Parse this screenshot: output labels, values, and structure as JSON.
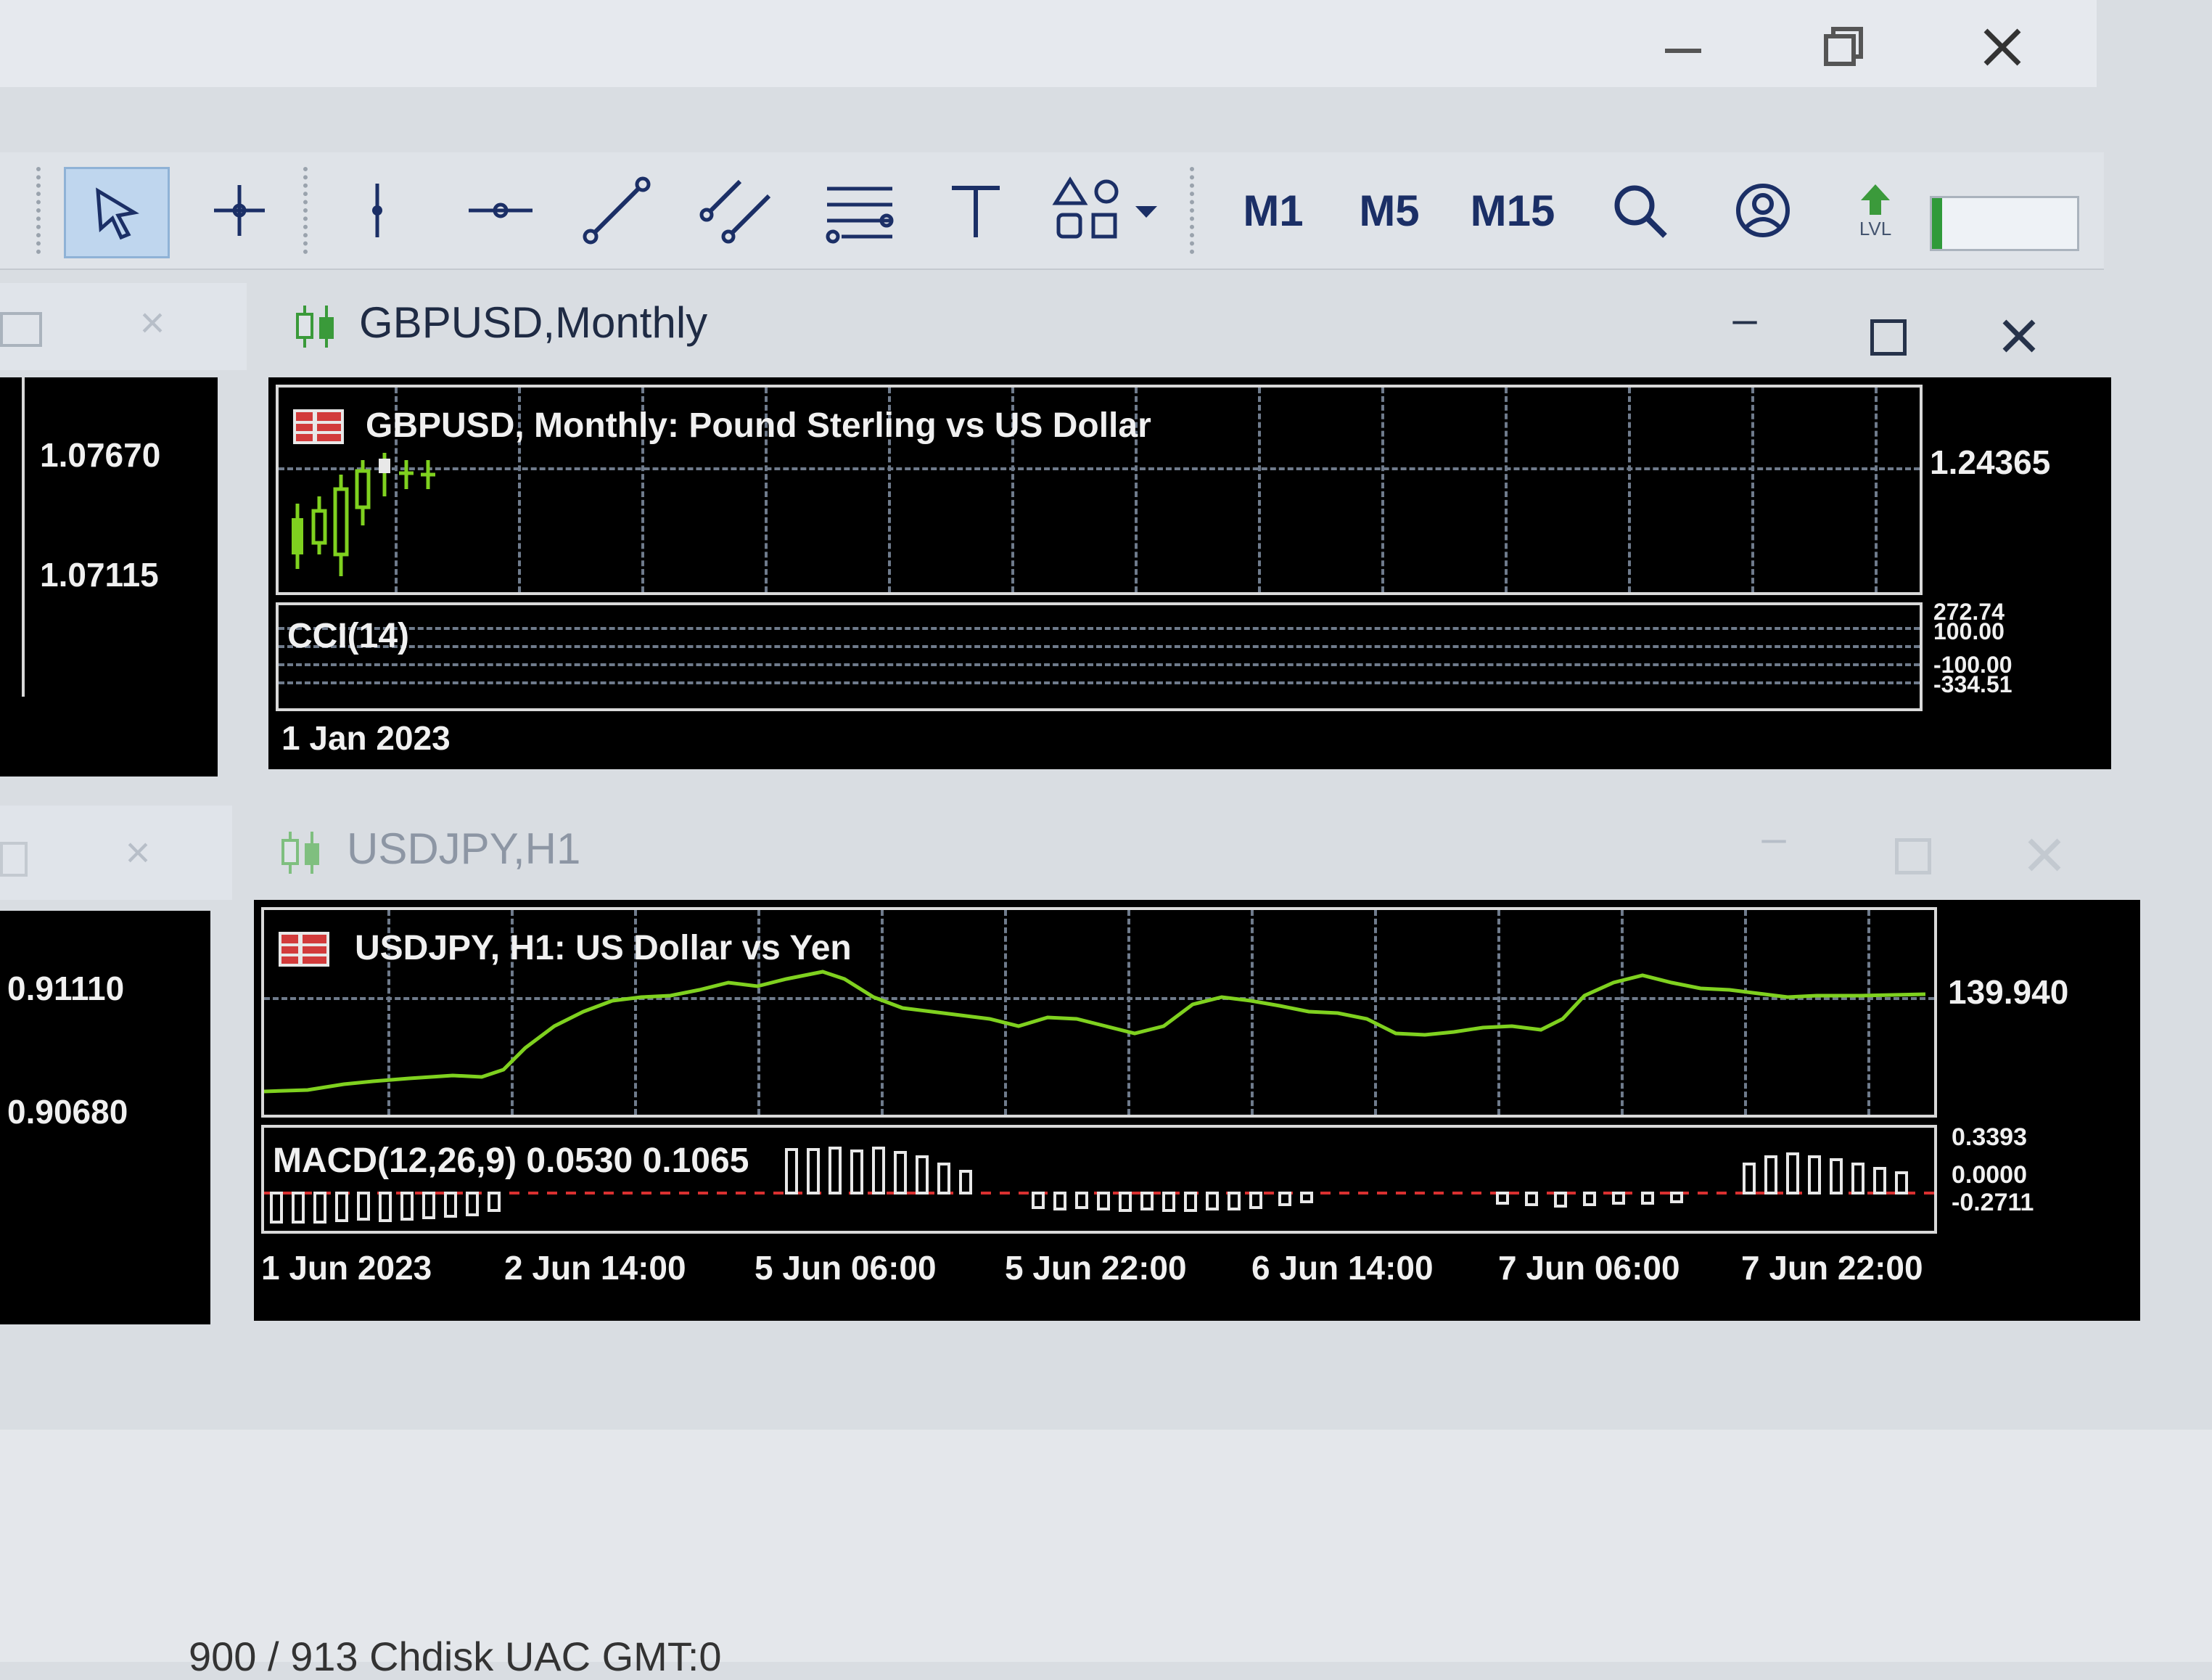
{
  "window": {
    "minimize_icon": "minimize-icon",
    "restore_icon": "restore-icon",
    "close_icon": "close-icon"
  },
  "toolbar": {
    "tools": [
      {
        "name": "cursor",
        "icon": "arrow-cursor-icon"
      },
      {
        "name": "crosshair",
        "icon": "crosshair-icon"
      },
      {
        "name": "vertical-line",
        "icon": "vertical-line-icon"
      },
      {
        "name": "horizontal-line",
        "icon": "horizontal-line-icon"
      },
      {
        "name": "trendline",
        "icon": "trendline-icon"
      },
      {
        "name": "equidistant-channel",
        "icon": "channel-icon"
      },
      {
        "name": "fibonacci",
        "icon": "fibonacci-icon"
      },
      {
        "name": "text",
        "icon": "text-icon"
      },
      {
        "name": "shapes",
        "icon": "shapes-icon"
      }
    ],
    "timeframes": [
      "M1",
      "M5",
      "M15"
    ],
    "level_label": "LVL"
  },
  "left_windows": {
    "top_prices": [
      "1.07670",
      "1.07115"
    ],
    "bottom_prices": [
      "0.91110",
      "0.90680"
    ]
  },
  "gbpusd": {
    "caption": "GBPUSD,Monthly",
    "title": "GBPUSD, Monthly:  Pound Sterling vs US Dollar",
    "price": "1.24365",
    "indicator": "CCI(14)",
    "indicator_values": [
      "272.74",
      "100.00",
      "-100.00",
      "-334.51"
    ],
    "time_labels": [
      "1 Jan 2023"
    ]
  },
  "usdjpy": {
    "caption": "USDJPY,H1",
    "title": "USDJPY, H1:  US Dollar vs Yen",
    "price": "139.940",
    "indicator": "MACD(12,26,9) 0.0530 0.1065",
    "indicator_values": [
      "0.3393",
      "0.0000",
      "-0.2711"
    ],
    "time_labels": [
      "1 Jun 2023",
      "2 Jun 14:00",
      "5 Jun 06:00",
      "5 Jun 22:00",
      "6 Jun 14:00",
      "7 Jun 06:00",
      "7 Jun 22:00"
    ]
  },
  "status": {
    "text": "900 / 913 Chdisk UAC GMT:0"
  },
  "colors": {
    "candle": "#7fd11f",
    "macd_hist": "#e8e8e8",
    "macd_signal": "#d93030",
    "background": "#000000"
  }
}
